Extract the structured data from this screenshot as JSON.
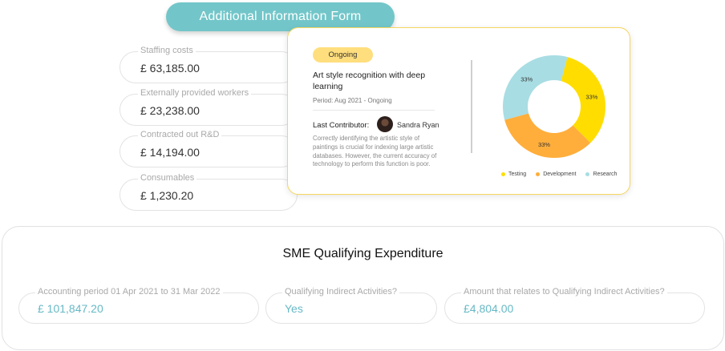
{
  "form": {
    "title": "Additional Information Form"
  },
  "fields": [
    {
      "label": "Staffing costs",
      "value": "£ 63,185.00"
    },
    {
      "label": "Externally provided workers",
      "value": "£ 23,238.00"
    },
    {
      "label": "Contracted out R&D",
      "value": "£ 14,194.00"
    },
    {
      "label": "Consumables",
      "value": "£ 1,230.20"
    }
  ],
  "project": {
    "status": "Ongoing",
    "title": "Art style recognition with deep learning",
    "period": "Period: Aug 2021 - Ongoing",
    "contributor_label": "Last Contributor:",
    "contributor_name": "Sandra Ryan",
    "description": "Correctly identifying the artistic style of paintings is crucial for indexing large artistic databases. However, the current accuracy of technology to perform this function is poor."
  },
  "chart_data": {
    "type": "pie",
    "donut": true,
    "categories": [
      "Testing",
      "Development",
      "Research"
    ],
    "values": [
      33,
      33,
      33
    ],
    "labels": [
      "33%",
      "33%",
      "33%"
    ],
    "colors": [
      "#ffdd00",
      "#ffae3b",
      "#a8dde3"
    ],
    "legend": "bottom"
  },
  "sme": {
    "title": "SME Qualifying Expenditure",
    "fields": [
      {
        "label": "Accounting period 01 Apr 2021 to 31 Mar 2022",
        "value": "£ 101,847.20"
      },
      {
        "label": "Qualifying Indirect Activities?",
        "value": "Yes"
      },
      {
        "label": "Amount that relates to Qualifying Indirect Activities?",
        "value": "£4,804.00"
      }
    ]
  }
}
